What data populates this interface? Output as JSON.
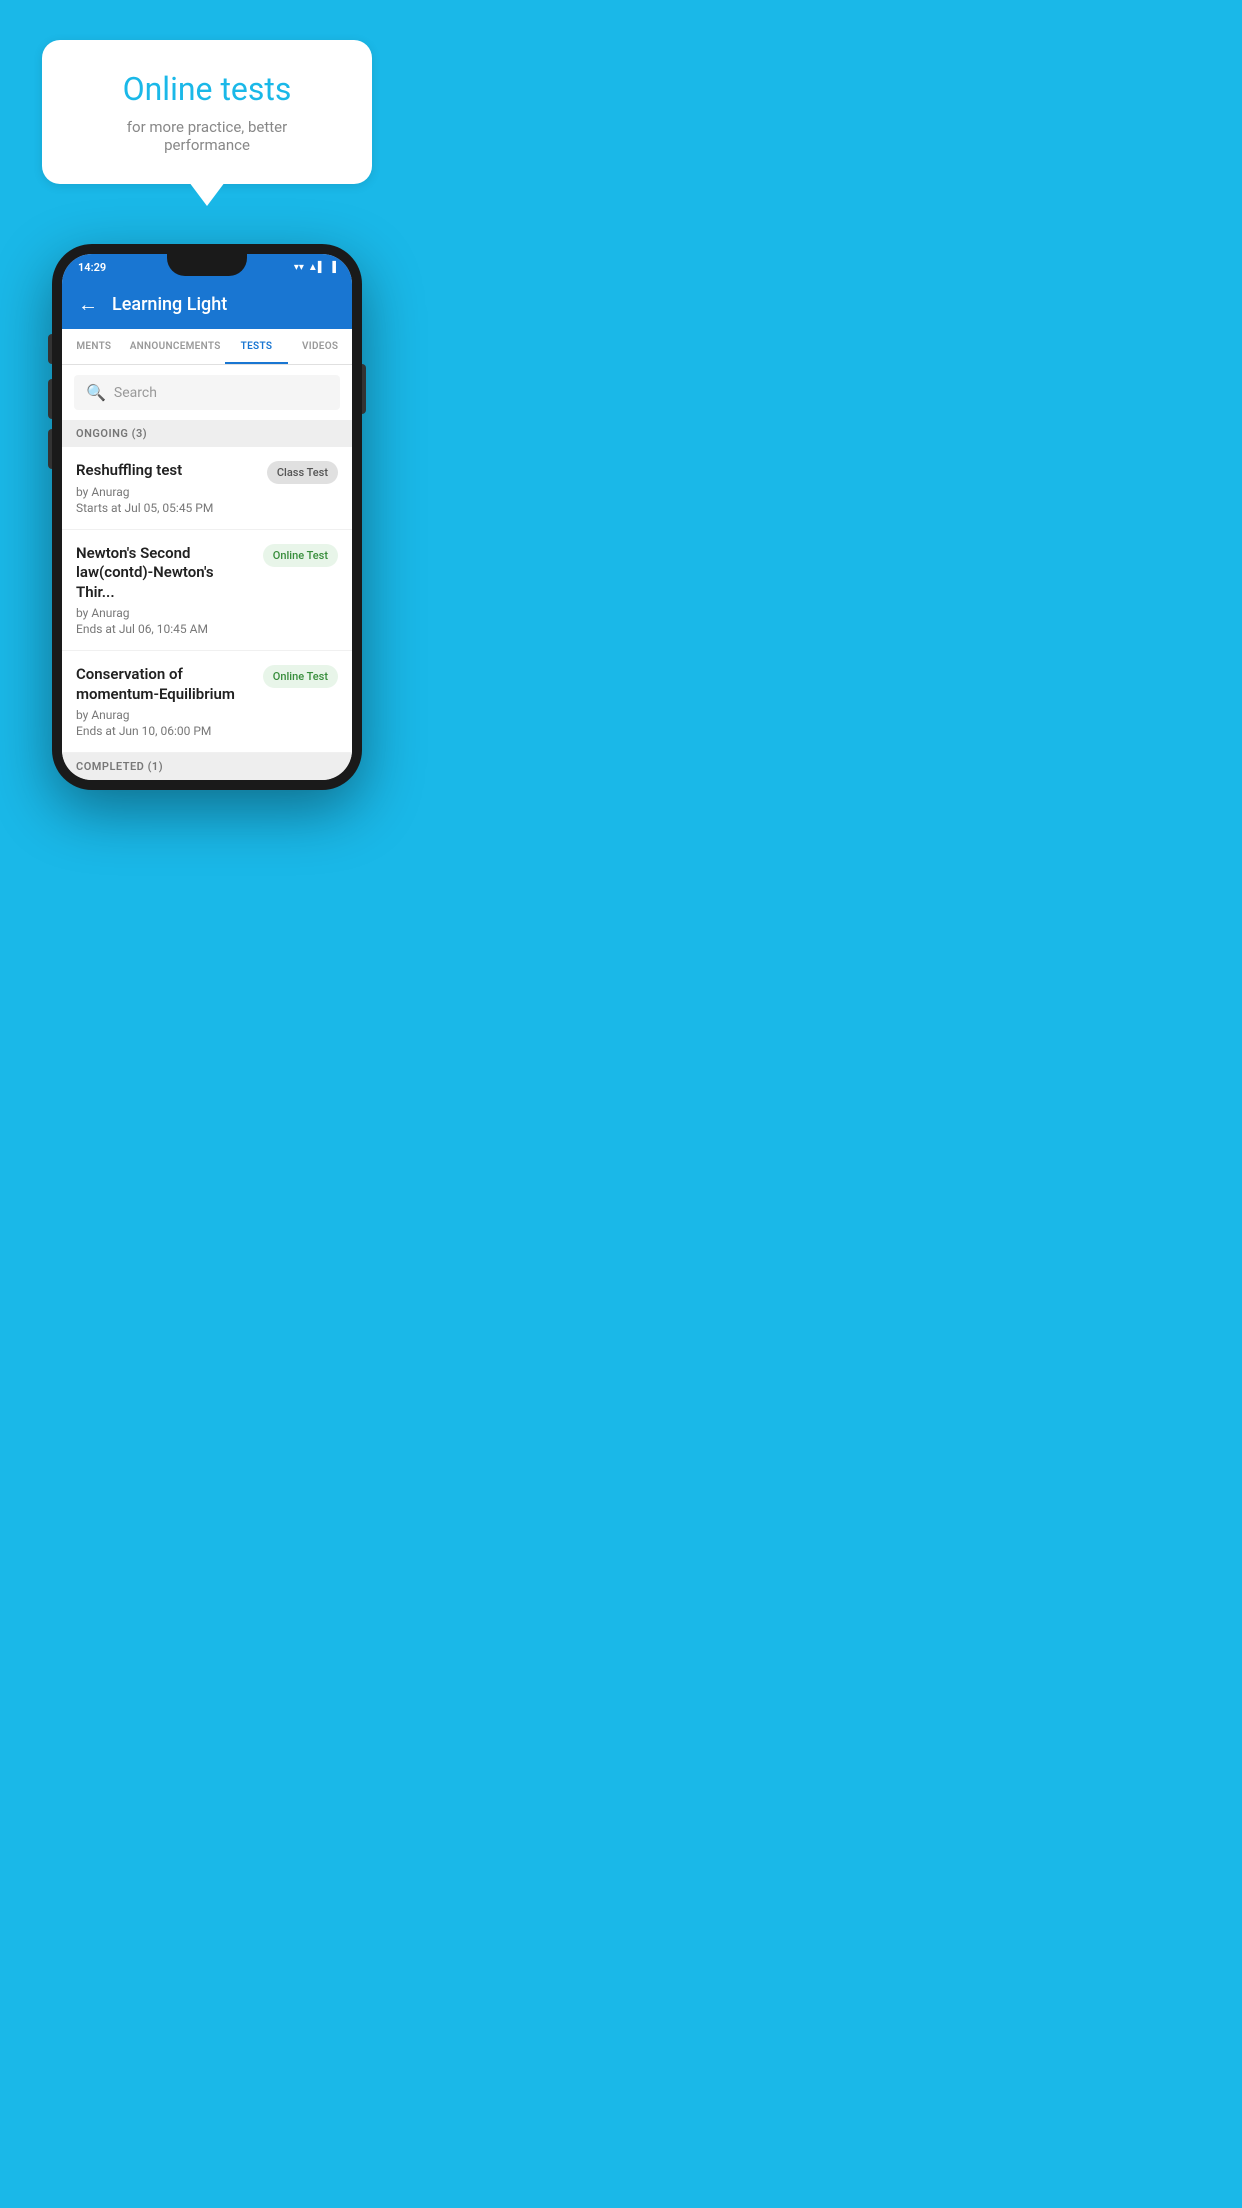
{
  "promo": {
    "title": "Online tests",
    "subtitle": "for more practice, better performance"
  },
  "status_bar": {
    "time": "14:29",
    "wifi_icon": "▼",
    "signal_icon": "▲",
    "battery_icon": "▌"
  },
  "app": {
    "title": "Learning Light",
    "back_label": "←"
  },
  "tabs": [
    {
      "label": "MENTS",
      "active": false
    },
    {
      "label": "ANNOUNCEMENTS",
      "active": false
    },
    {
      "label": "TESTS",
      "active": true
    },
    {
      "label": "VIDEOS",
      "active": false
    }
  ],
  "search": {
    "placeholder": "Search"
  },
  "sections": {
    "ongoing": {
      "label": "ONGOING (3)",
      "items": [
        {
          "name": "Reshuffling test",
          "author": "by Anurag",
          "date": "Starts at  Jul 05, 05:45 PM",
          "badge": "Class Test",
          "badge_type": "class"
        },
        {
          "name": "Newton's Second law(contd)-Newton's Thir...",
          "author": "by Anurag",
          "date": "Ends at  Jul 06, 10:45 AM",
          "badge": "Online Test",
          "badge_type": "online"
        },
        {
          "name": "Conservation of momentum-Equilibrium",
          "author": "by Anurag",
          "date": "Ends at  Jun 10, 06:00 PM",
          "badge": "Online Test",
          "badge_type": "online"
        }
      ]
    },
    "completed": {
      "label": "COMPLETED (1)"
    }
  }
}
